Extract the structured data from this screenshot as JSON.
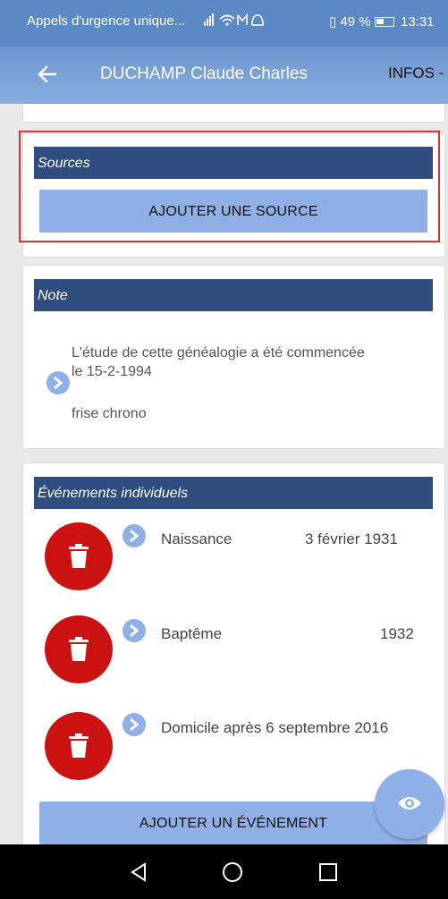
{
  "status_bar": {
    "notification_text": "Appels d'urgence unique...",
    "icons": "signal wifi mail sync",
    "battery": "49 %",
    "time": "13:31"
  },
  "app_bar": {
    "back_icon": "arrow-left-icon",
    "title": "DUCHAMP Claude Charles",
    "tab_label": "INFOS -"
  },
  "sources": {
    "heading": "Sources",
    "add_button": "AJOUTER UNE SOURCE"
  },
  "note": {
    "heading": "Note",
    "text": "L'étude de cette généalogie a été commencée le 15-2-1994",
    "subtext": "frise chrono"
  },
  "events": {
    "heading": "Événements individuels",
    "items": [
      {
        "label": "Naissance",
        "date": "3 février 1931"
      },
      {
        "label": "Baptême",
        "date": "1932"
      },
      {
        "label": "Domicile après 6 septembre 2016",
        "date": ""
      }
    ],
    "add_button": "AJOUTER UN ÉVÉNEMENT"
  },
  "colors": {
    "header_dark": "#2f4d7e",
    "button_light": "#8fb0e6",
    "delete_red": "#cc1111",
    "highlight_border": "#d73535",
    "app_bar": "#6d96cf"
  }
}
